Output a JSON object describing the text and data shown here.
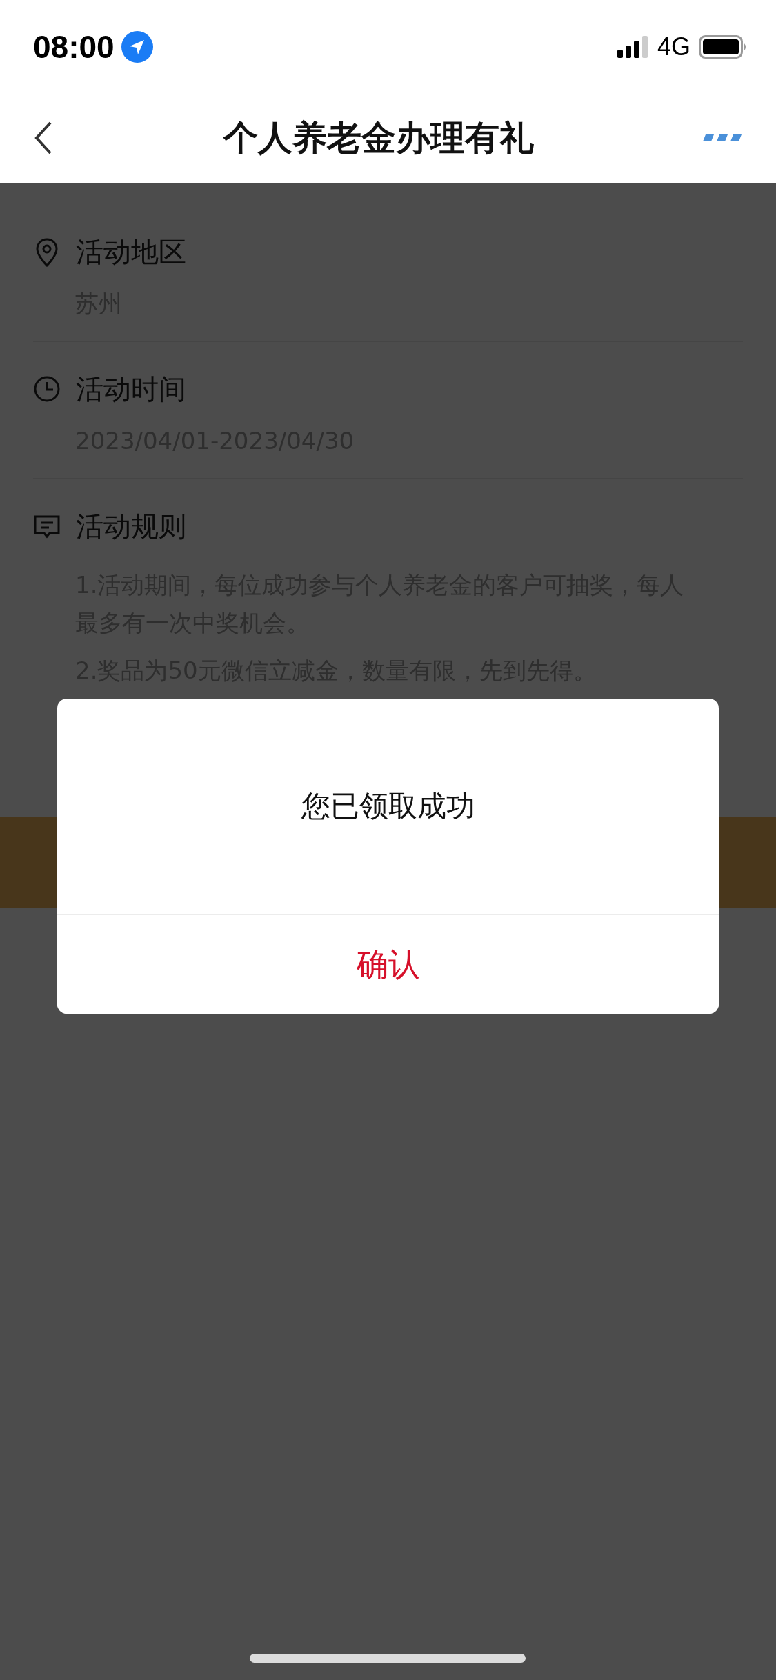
{
  "status_bar": {
    "time": "08:00",
    "network": "4G"
  },
  "nav": {
    "title": "个人养老金办理有礼"
  },
  "sections": [
    {
      "kind": "location",
      "heading": "活动地区",
      "lines": [
        "苏州"
      ]
    },
    {
      "kind": "time",
      "heading": "活动时间",
      "lines": [
        "2023/04/01-2023/04/30"
      ]
    },
    {
      "kind": "rules",
      "heading": "活动规则",
      "lines": [
        "1.活动期间，每位成功参与个人养老金的客户可抽奖，每人最多有一次中奖机会。",
        "2.奖品为50元微信立减金，数量有限，先到先得。"
      ]
    }
  ],
  "dialog": {
    "message": "您已领取成功",
    "button": "确认"
  }
}
